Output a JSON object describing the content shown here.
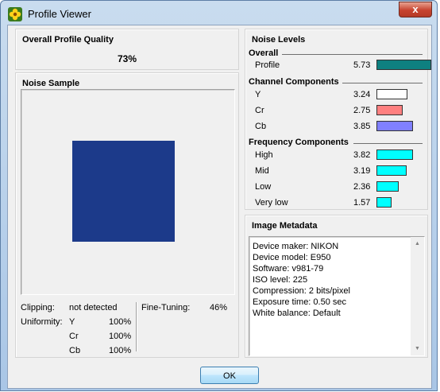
{
  "window": {
    "title": "Profile Viewer",
    "close_symbol": "x"
  },
  "quality": {
    "heading": "Overall Profile Quality",
    "value": "73%"
  },
  "noise_sample": {
    "heading": "Noise Sample",
    "swatch_color": "#1c3a8a",
    "clipping_label": "Clipping:",
    "clipping_value": "not detected",
    "uniformity_label": "Uniformity:",
    "uniformity": [
      {
        "channel": "Y",
        "value": "100%"
      },
      {
        "channel": "Cr",
        "value": "100%"
      },
      {
        "channel": "Cb",
        "value": "100%"
      }
    ],
    "fine_tuning_label": "Fine-Tuning:",
    "fine_tuning_value": "46%"
  },
  "noise_levels": {
    "heading": "Noise Levels",
    "overall": {
      "heading": "Overall",
      "items": [
        {
          "label": "Profile",
          "value": "5.73",
          "level": 5.73,
          "color": "#0e8080"
        }
      ]
    },
    "channel": {
      "heading": "Channel Components",
      "items": [
        {
          "label": "Y",
          "value": "3.24",
          "level": 3.24,
          "color": "#ffffff"
        },
        {
          "label": "Cr",
          "value": "2.75",
          "level": 2.75,
          "color": "#ff8080"
        },
        {
          "label": "Cb",
          "value": "3.85",
          "level": 3.85,
          "color": "#8080ff"
        }
      ]
    },
    "frequency": {
      "heading": "Frequency Components",
      "items": [
        {
          "label": "High",
          "value": "3.82",
          "level": 3.82,
          "color": "#00ffff"
        },
        {
          "label": "Mid",
          "value": "3.19",
          "level": 3.19,
          "color": "#00ffff"
        },
        {
          "label": "Low",
          "value": "2.36",
          "level": 2.36,
          "color": "#00ffff"
        },
        {
          "label": "Very low",
          "value": "1.57",
          "level": 1.57,
          "color": "#00ffff"
        }
      ]
    }
  },
  "metadata": {
    "heading": "Image Metadata",
    "lines": [
      "Device maker: NIKON",
      "Device model: E950",
      "Software: v981-79",
      "ISO level: 225",
      "Compression: 2 bits/pixel",
      "Exposure time: 0.50 sec",
      "White balance: Default"
    ]
  },
  "ok_label": "OK"
}
